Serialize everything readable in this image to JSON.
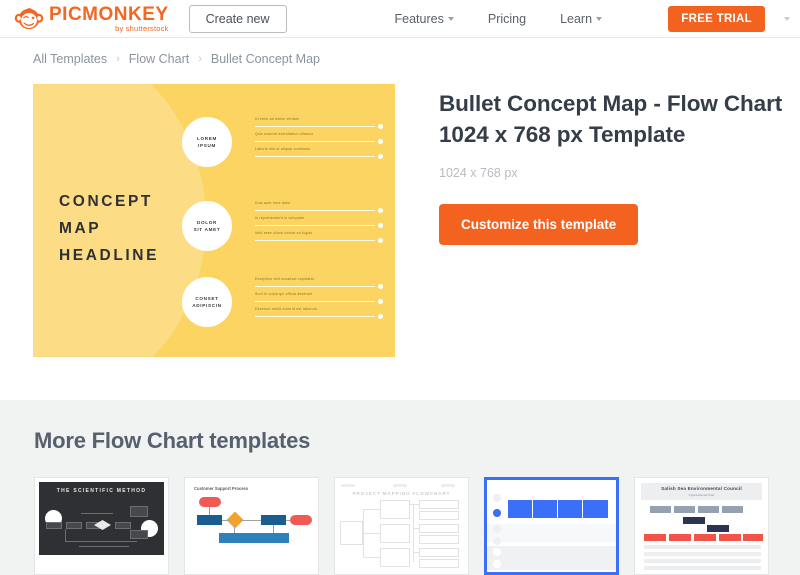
{
  "header": {
    "logo": {
      "word": "PICMONKEY",
      "sub": "by shutterstock",
      "icon": "monkey-icon"
    },
    "create_new_label": "Create new",
    "nav": [
      {
        "label": "Features",
        "has_chevron": true
      },
      {
        "label": "Pricing",
        "has_chevron": false
      },
      {
        "label": "Learn",
        "has_chevron": true
      }
    ],
    "free_trial_label": "FREE TRIAL",
    "account_label": ""
  },
  "breadcrumb": {
    "separator": "›",
    "items": [
      {
        "label": "All Templates"
      },
      {
        "label": "Flow Chart"
      },
      {
        "label": "Bullet Concept Map"
      }
    ]
  },
  "preview": {
    "headline_lines": [
      "CONCEPT",
      "MAP",
      "HEADLINE"
    ],
    "circles": [
      {
        "line1": "LOREM",
        "line2": "IPSUM"
      },
      {
        "line1": "DOLOR",
        "line2": "SIT AMET"
      },
      {
        "line1": "CONSET",
        "line2": "ADIPISCIN"
      }
    ],
    "bullet_groups": [
      [
        "Ut enim ad minim veniam",
        "Quis nostrud exercitation ullamco",
        "Laboris nisi ut aliquip commodo"
      ],
      [
        "Duis aute irure dolor",
        "In reprehenderit in voluptate",
        "Velit esse cillum dolore eu fugiat"
      ],
      [
        "Excepteur sint occaecat cupidatat",
        "Sunt in culpa qui officia deserunt",
        "Deserunt mollit anim id est laborum"
      ]
    ]
  },
  "detail": {
    "title_line1": "Bullet Concept Map - Flow Chart",
    "title_line2": "1024 x 768 px Template",
    "dimensions": "1024 x 768 px",
    "cta_label": "Customize this template"
  },
  "more": {
    "heading": "More Flow Chart templates",
    "thumbnails": [
      {
        "id": "scientific-method",
        "title": "THE SCIENTIFIC METHOD",
        "selected": false
      },
      {
        "id": "customer-support-process",
        "title": "Customer Support Process",
        "selected": false
      },
      {
        "id": "project-mapping-flowchart",
        "title": "PROJECT MAPPING FLOWCHART",
        "selected": false
      },
      {
        "id": "timeline-chart",
        "title": "",
        "selected": true
      },
      {
        "id": "salish-sea-org-chart",
        "title": "Salish Sea Environmental Council",
        "subtitle": "Organizational Chart",
        "selected": false
      }
    ]
  },
  "colors": {
    "brand_orange": "#f4621f",
    "template_yellow": "#fcd462",
    "template_yellow_light": "#fcdd85",
    "heading_slate": "#343d48",
    "muted_gray": "#8c939d",
    "selected_blue": "#3a6ff7",
    "section_bg": "#f1f2f2"
  }
}
